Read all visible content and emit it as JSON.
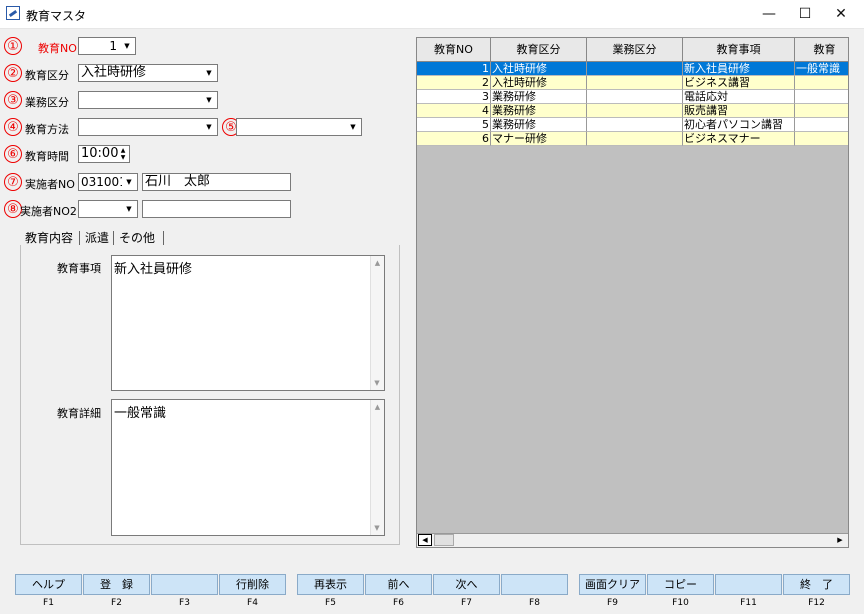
{
  "window": {
    "title": "教育マスタ",
    "minimize": "—",
    "maximize": "☐",
    "close": "✕"
  },
  "markers": [
    "①",
    "②",
    "③",
    "④",
    "⑤",
    "⑥",
    "⑦",
    "⑧"
  ],
  "form": {
    "edu_no": {
      "label": "教育NO",
      "value": "1"
    },
    "edu_category": {
      "label": "教育区分",
      "value": "入社時研修"
    },
    "business_category": {
      "label": "業務区分",
      "value": ""
    },
    "edu_method": {
      "label": "教育方法",
      "value": "",
      "value2": ""
    },
    "edu_time": {
      "label": "教育時間",
      "value": "10:00"
    },
    "implementer_no": {
      "label": "実施者NO",
      "code": "031001",
      "name": "石川　太郎"
    },
    "implementer_no2": {
      "label": "実施者NO2",
      "code": "",
      "name": ""
    }
  },
  "tabs": [
    "教育内容",
    "派遣",
    "その他"
  ],
  "content": {
    "item_label": "教育事項",
    "item_value": "新入社員研修",
    "detail_label": "教育詳細",
    "detail_value": "一般常識"
  },
  "grid": {
    "columns": [
      "教育NO",
      "教育区分",
      "業務区分",
      "教育事項",
      "教育"
    ],
    "rows": [
      {
        "no": "1",
        "category": "入社時研修",
        "business": "",
        "item": "新入社員研修",
        "extra": "一般常識",
        "selected": true
      },
      {
        "no": "2",
        "category": "入社時研修",
        "business": "",
        "item": "ビジネス講習",
        "extra": ""
      },
      {
        "no": "3",
        "category": "業務研修",
        "business": "",
        "item": "電話応対",
        "extra": ""
      },
      {
        "no": "4",
        "category": "業務研修",
        "business": "",
        "item": "販売講習",
        "extra": ""
      },
      {
        "no": "5",
        "category": "業務研修",
        "business": "",
        "item": "初心者パソコン講習",
        "extra": ""
      },
      {
        "no": "6",
        "category": "マナー研修",
        "business": "",
        "item": "ビジネスマナー",
        "extra": ""
      }
    ]
  },
  "fkeys": [
    {
      "label": "ヘルプ",
      "key": "F1"
    },
    {
      "label": "登　録",
      "key": "F2"
    },
    {
      "label": "",
      "key": "F3"
    },
    {
      "label": "行削除",
      "key": "F4"
    },
    {
      "label": "再表示",
      "key": "F5"
    },
    {
      "label": "前へ",
      "key": "F6"
    },
    {
      "label": "次へ",
      "key": "F7"
    },
    {
      "label": "",
      "key": "F8"
    },
    {
      "label": "画面クリア",
      "key": "F9"
    },
    {
      "label": "コピー",
      "key": "F10"
    },
    {
      "label": "",
      "key": "F11"
    },
    {
      "label": "終　了",
      "key": "F12"
    }
  ],
  "colors": {
    "selected_row": "#0078d7",
    "alt_row": "#ffffcc",
    "marker": "#e00000",
    "fkey_bg": "#cde4f7"
  }
}
